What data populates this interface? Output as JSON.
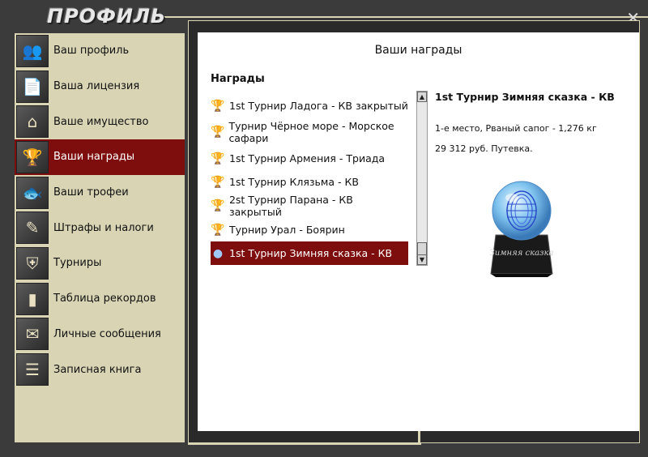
{
  "window": {
    "title": "ПРОФИЛЬ",
    "close_label": "✕"
  },
  "sidebar": {
    "items": [
      {
        "label": "Ваш профиль",
        "icon": "users-icon"
      },
      {
        "label": "Ваша лицензия",
        "icon": "license-icon"
      },
      {
        "label": "Ваше имущество",
        "icon": "house-icon"
      },
      {
        "label": "Ваши награды",
        "icon": "trophy-icon"
      },
      {
        "label": "Ваши трофеи",
        "icon": "fish-icon"
      },
      {
        "label": "Штрафы и налоги",
        "icon": "document-pen-icon"
      },
      {
        "label": "Турниры",
        "icon": "shield-icon"
      },
      {
        "label": "Таблица рекордов",
        "icon": "bar-chart-icon"
      },
      {
        "label": "Личные сообщения",
        "icon": "envelope-icon"
      },
      {
        "label": "Записная книга",
        "icon": "notebook-icon"
      }
    ],
    "active_index": 3
  },
  "main": {
    "heading": "Ваши награды",
    "list_title": "Награды",
    "awards": [
      {
        "label": "1st Турнир Ладога - КВ закрытый",
        "icon": "goblet-icon"
      },
      {
        "label": "Турнир Чёрное море - Морское сафари",
        "icon": "fish-trophy-icon"
      },
      {
        "label": "1st Турнир Армения - Триада",
        "icon": "figurine-trophy-icon"
      },
      {
        "label": "1st Турнир Клязьма - КВ",
        "icon": "bear-trophy-icon"
      },
      {
        "label": "2st Турнир Парана - КВ закрытый",
        "icon": "fish-trophy-icon"
      },
      {
        "label": "Турнир Урал - Боярин",
        "icon": "cup-icon"
      },
      {
        "label": "1st Турнир Зимняя сказка - КВ",
        "icon": "crystal-ball-icon"
      }
    ],
    "selected_index": 6,
    "detail": {
      "title": "1st Турнир Зимняя сказка - КВ",
      "line1": "1-е место, Рваный сапог - 1,276 кг",
      "line2": "29 312 руб. Путевка.",
      "trophy_text": "Зимняя сказка"
    }
  },
  "colors": {
    "accent": "#7e0d0d",
    "sidebar_bg": "#d8d4b4",
    "frame_bg": "#3b3b3b"
  }
}
